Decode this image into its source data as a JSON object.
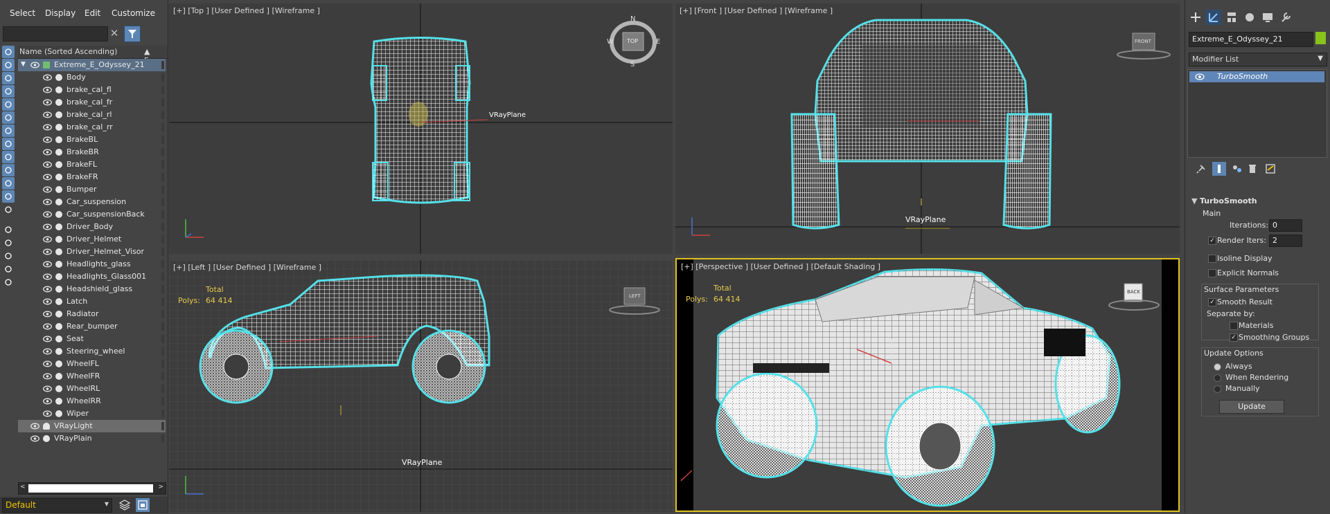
{
  "menu": [
    "Select",
    "Display",
    "Edit",
    "Customize"
  ],
  "explorer": {
    "column_name": "Name (Sorted Ascending)",
    "column_frozen": "▲ Froze",
    "root": "Extreme_E_Odyssey_21",
    "children": [
      "Body",
      "brake_cal_fl",
      "brake_cal_fr",
      "brake_cal_rl",
      "brake_cal_rr",
      "BrakeBL",
      "BrakeBR",
      "BrakeFL",
      "BrakeFR",
      "Bumper",
      "Car_suspension",
      "Car_suspensionBack",
      "Driver_Body",
      "Driver_Helmet",
      "Driver_Helmet_Visor",
      "Headlights_glass",
      "Headlights_Glass001",
      "Headshield_glass",
      "Latch",
      "Radiator",
      "Rear_bumper",
      "Seat",
      "Steering_wheel",
      "WheelFL",
      "WheelFR",
      "WheelRL",
      "WheelRR",
      "Wiper"
    ],
    "others": [
      "VRayLight",
      "VRayPlain"
    ],
    "layer": "Default"
  },
  "viewports": {
    "top": {
      "label": "[+] [Top ] [User Defined ] [Wireframe ]",
      "cube": "TOP",
      "compass": [
        "N",
        "S",
        "E",
        "W"
      ],
      "object_label": "VRayPlane"
    },
    "front": {
      "label": "[+] [Front ] [User Defined ] [Wireframe ]",
      "cube": "FRONT",
      "object_label": "VRayPlane"
    },
    "left": {
      "label": "[+] [Left ] [User Defined ] [Wireframe ]",
      "cube": "LEFT",
      "stats_title": "Total",
      "polys_label": "Polys:",
      "polys_value": "64 414",
      "object_label": "VRayPlane"
    },
    "persp": {
      "label": "[+] [Perspective ] [User Defined ] [Default Shading ]",
      "cube": "BACK",
      "stats_title": "Total",
      "polys_label": "Polys:",
      "polys_value": "64 414"
    }
  },
  "command_panel": {
    "object_name": "Extreme_E_Odyssey_21",
    "object_color": "#88c21a",
    "modifier_list": "Modifier List",
    "stack_item": "TurboSmooth",
    "rollout_title": "TurboSmooth",
    "main_label": "Main",
    "iterations_label": "Iterations:",
    "iterations_value": "0",
    "render_iters_label": "Render Iters:",
    "render_iters_value": "2",
    "render_iters_checked": true,
    "isoline_label": "Isoline Display",
    "explicit_normals_label": "Explicit Normals",
    "surface_params_label": "Surface Parameters",
    "smooth_result_label": "Smooth Result",
    "separate_by_label": "Separate by:",
    "materials_label": "Materials",
    "smoothing_groups_label": "Smoothing Groups",
    "update_options_label": "Update Options",
    "always_label": "Always",
    "when_rendering_label": "When Rendering",
    "manually_label": "Manually",
    "update_button": "Update"
  },
  "colors": {
    "accent": "#5d86b4",
    "selection_outline": "#55e0e8",
    "wire": "#ffffff",
    "active_viewport": "#e0c21d",
    "stats": "#e8c94c"
  }
}
